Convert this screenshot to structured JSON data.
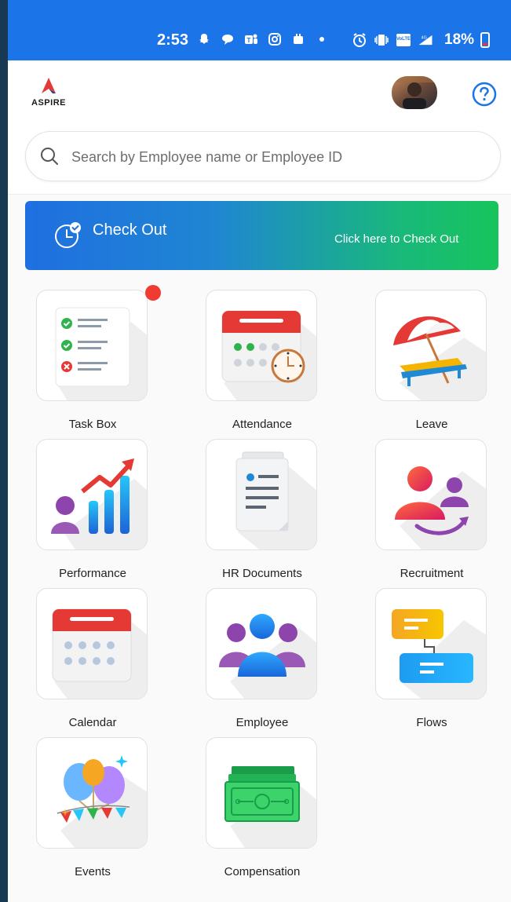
{
  "status_bar": {
    "time": "2:53",
    "battery": "18%"
  },
  "app": {
    "logo_text": "ASPIRE"
  },
  "search": {
    "placeholder": "Search by Employee name or Employee ID"
  },
  "checkout": {
    "title": "Check Out",
    "subtitle": "Click here to Check Out"
  },
  "modules": [
    {
      "label": "Task Box",
      "icon": "task-box-icon",
      "has_notification": true
    },
    {
      "label": "Attendance",
      "icon": "attendance-icon"
    },
    {
      "label": "Leave",
      "icon": "leave-icon"
    },
    {
      "label": "Performance",
      "icon": "performance-icon"
    },
    {
      "label": "HR Documents",
      "icon": "hr-documents-icon"
    },
    {
      "label": "Recruitment",
      "icon": "recruitment-icon"
    },
    {
      "label": "Calendar",
      "icon": "calendar-icon"
    },
    {
      "label": "Employee",
      "icon": "employee-icon"
    },
    {
      "label": "Flows",
      "icon": "flows-icon"
    },
    {
      "label": "Events",
      "icon": "events-icon"
    },
    {
      "label": "Compensation",
      "icon": "compensation-icon"
    }
  ],
  "colors": {
    "status_bar": "#1b74e8",
    "checkout_start": "#1f6fe0",
    "checkout_end": "#17c45b",
    "notification": "#ef3b32"
  }
}
